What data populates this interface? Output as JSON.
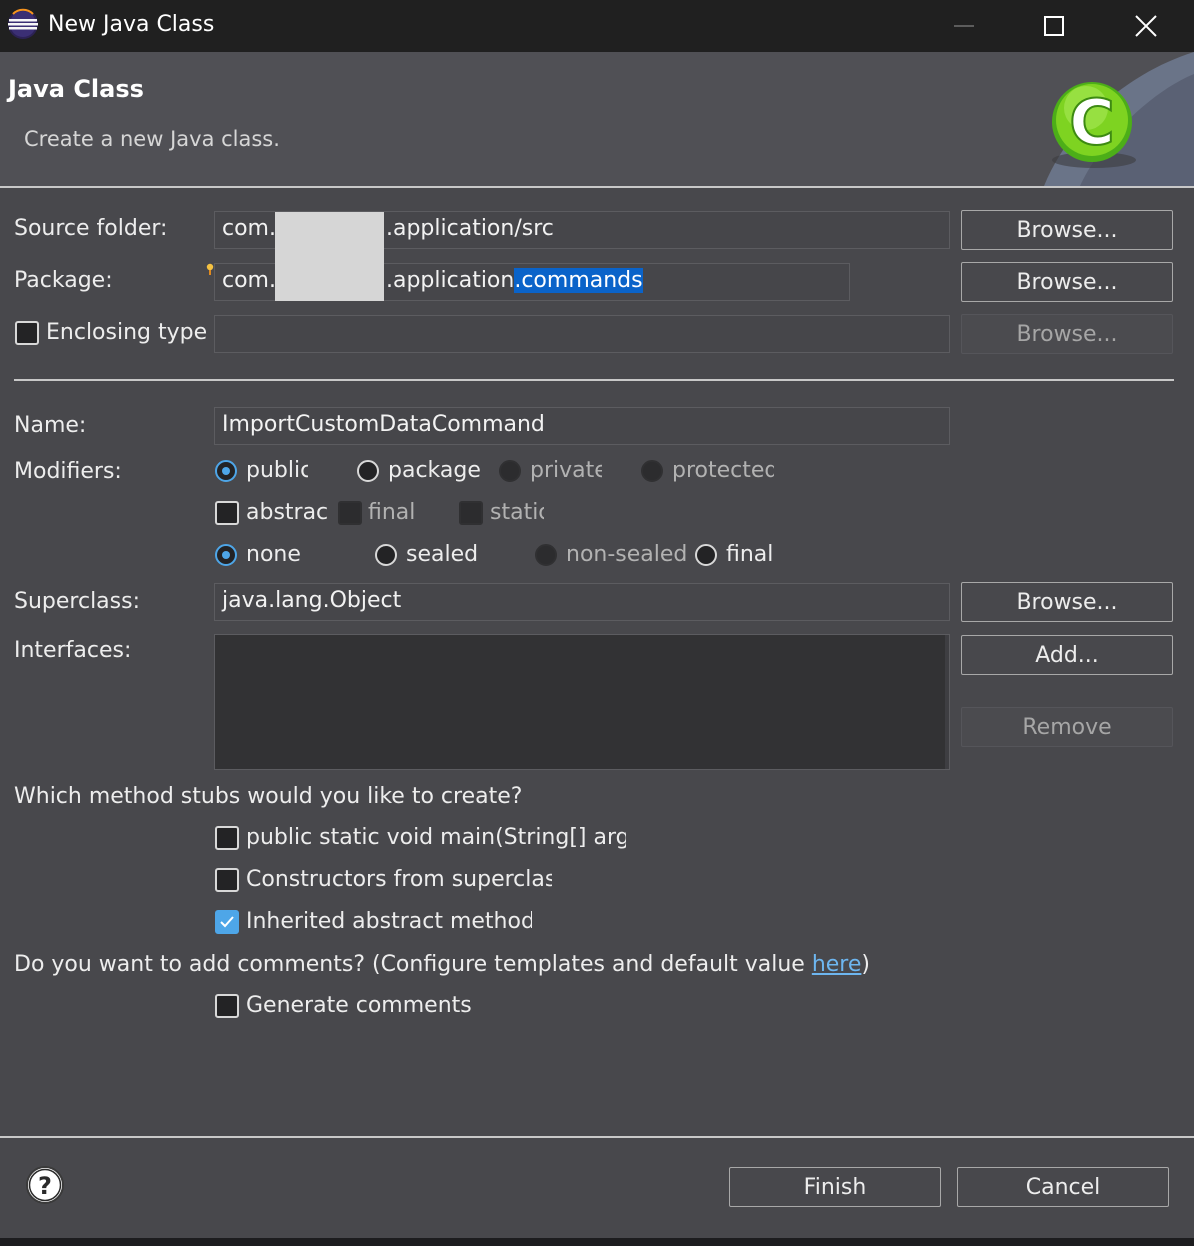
{
  "window": {
    "title": "New Java Class",
    "minimize_icon": "minimize-icon",
    "maximize_icon": "maximize-icon",
    "close_icon": "close-icon"
  },
  "header": {
    "title": "Java Class",
    "subtitle": "Create a new Java class."
  },
  "source_folder": {
    "label": "Source folder:",
    "value_prefix": "com.",
    "value_suffix": ".application/src",
    "browse": "Browse..."
  },
  "package": {
    "label": "Package:",
    "value_prefix": "com.",
    "value_middle": ".application",
    "value_selected": ".commands",
    "browse": "Browse..."
  },
  "enclosing_type": {
    "label": "Enclosing type:",
    "value": "",
    "browse": "Browse..."
  },
  "name": {
    "label": "Name:",
    "value": "ImportCustomDataCommand"
  },
  "modifiers": {
    "label": "Modifiers:",
    "access": [
      "public",
      "package",
      "private",
      "protected"
    ],
    "access_selected": "public",
    "flags": [
      "abstract",
      "final",
      "static"
    ],
    "sealing": [
      "none",
      "sealed",
      "non-sealed",
      "final"
    ],
    "sealing_selected": "none"
  },
  "superclass": {
    "label": "Superclass:",
    "value": "java.lang.Object",
    "browse": "Browse..."
  },
  "interfaces": {
    "label": "Interfaces:",
    "add": "Add...",
    "remove": "Remove"
  },
  "stubs": {
    "question": "Which method stubs would you like to create?",
    "main": "public static void main(String[] args)",
    "constructors": "Constructors from superclass",
    "inherited": "Inherited abstract methods"
  },
  "comments": {
    "question_start": "Do you want to add comments? (Configure templates and default value ",
    "link": "here",
    "question_end": ")",
    "generate": "Generate comments"
  },
  "footer": {
    "help_icon": "help-icon",
    "finish": "Finish",
    "cancel": "Cancel"
  },
  "colors": {
    "accent": "#4ea6e8",
    "selection": "#0a63c9",
    "background": "#48484c"
  }
}
